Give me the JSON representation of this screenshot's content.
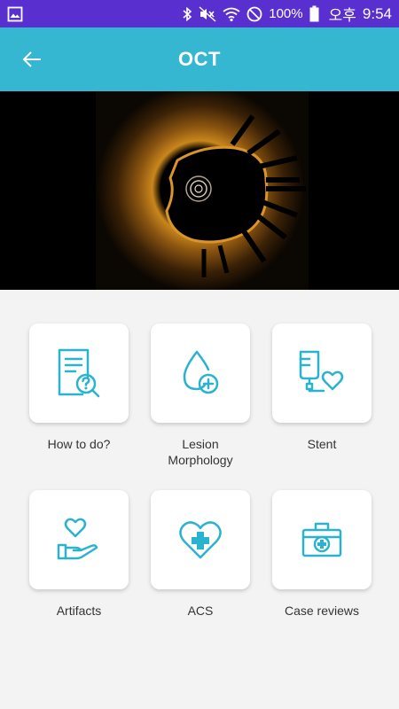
{
  "status_bar": {
    "battery": "100%",
    "ampm": "오후",
    "time": "9:54"
  },
  "app_bar": {
    "title": "OCT",
    "back_icon": "arrow-left-icon"
  },
  "hero": {
    "description_icon": "oct-scan-image"
  },
  "menu": [
    {
      "label_line1": "How to do?",
      "label_line2": "",
      "icon": "document-question-icon"
    },
    {
      "label_line1": "Lesion",
      "label_line2": "Morphology",
      "icon": "drop-plus-icon"
    },
    {
      "label_line1": "Stent",
      "label_line2": "",
      "icon": "iv-bag-heart-icon"
    },
    {
      "label_line1": "Artifacts",
      "label_line2": "",
      "icon": "hand-heart-icon"
    },
    {
      "label_line1": "ACS",
      "label_line2": "",
      "icon": "heart-plus-icon"
    },
    {
      "label_line1": "Case reviews",
      "label_line2": "",
      "icon": "first-aid-kit-icon"
    }
  ],
  "colors": {
    "status_bar": "#5a2fd0",
    "app_bar": "#35b6d1",
    "icon": "#2ab3cf"
  }
}
